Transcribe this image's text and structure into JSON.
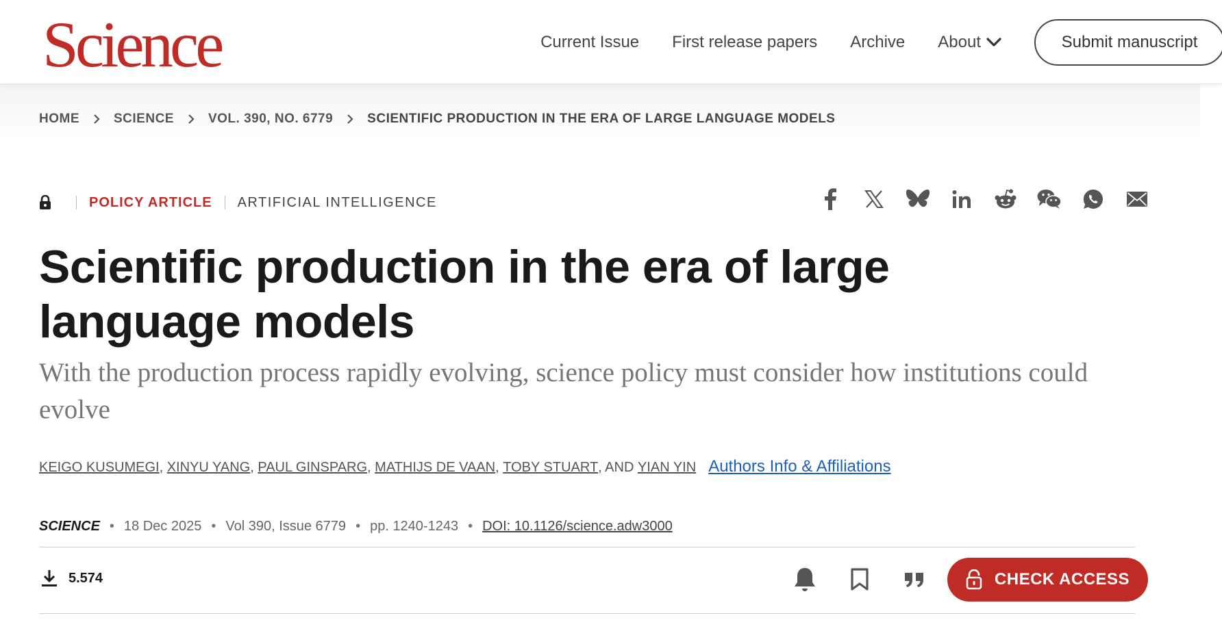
{
  "header": {
    "logo": "Science",
    "nav": [
      {
        "label": "Current Issue"
      },
      {
        "label": "First release papers"
      },
      {
        "label": "Archive"
      },
      {
        "label": "About"
      }
    ],
    "submit_label": "Submit manuscript"
  },
  "breadcrumb": [
    "HOME",
    "SCIENCE",
    "VOL. 390, NO. 6779",
    "SCIENTIFIC PRODUCTION IN THE ERA OF LARGE LANGUAGE MODELS"
  ],
  "article": {
    "type": "POLICY ARTICLE",
    "topic": "ARTIFICIAL INTELLIGENCE",
    "title": "Scientific production in the era of large language models",
    "subtitle": "With the production process rapidly evolving, science policy must consider how institutions could evolve",
    "authors": [
      "KEIGO KUSUMEGI",
      "XINYU YANG",
      "PAUL GINSPARG",
      "MATHIJS DE VAAN",
      "TOBY STUART",
      "YIAN YIN"
    ],
    "authors_and": ", AND ",
    "authors_comma": ", ",
    "affiliations_link": "Authors Info & Affiliations",
    "journal": "SCIENCE",
    "date": "18 Dec 2025",
    "volume": "Vol 390, Issue 6779",
    "pages": "pp. 1240-1243",
    "doi": "DOI: 10.1126/science.adw3000",
    "downloads": "5.574",
    "check_access_label": "CHECK ACCESS"
  },
  "share_icons": [
    "facebook-icon",
    "x-icon",
    "bluesky-icon",
    "linkedin-icon",
    "reddit-icon",
    "wechat-icon",
    "whatsapp-icon",
    "email-icon"
  ],
  "colors": {
    "brand": "#c02b26",
    "link": "#1c5fb8"
  }
}
